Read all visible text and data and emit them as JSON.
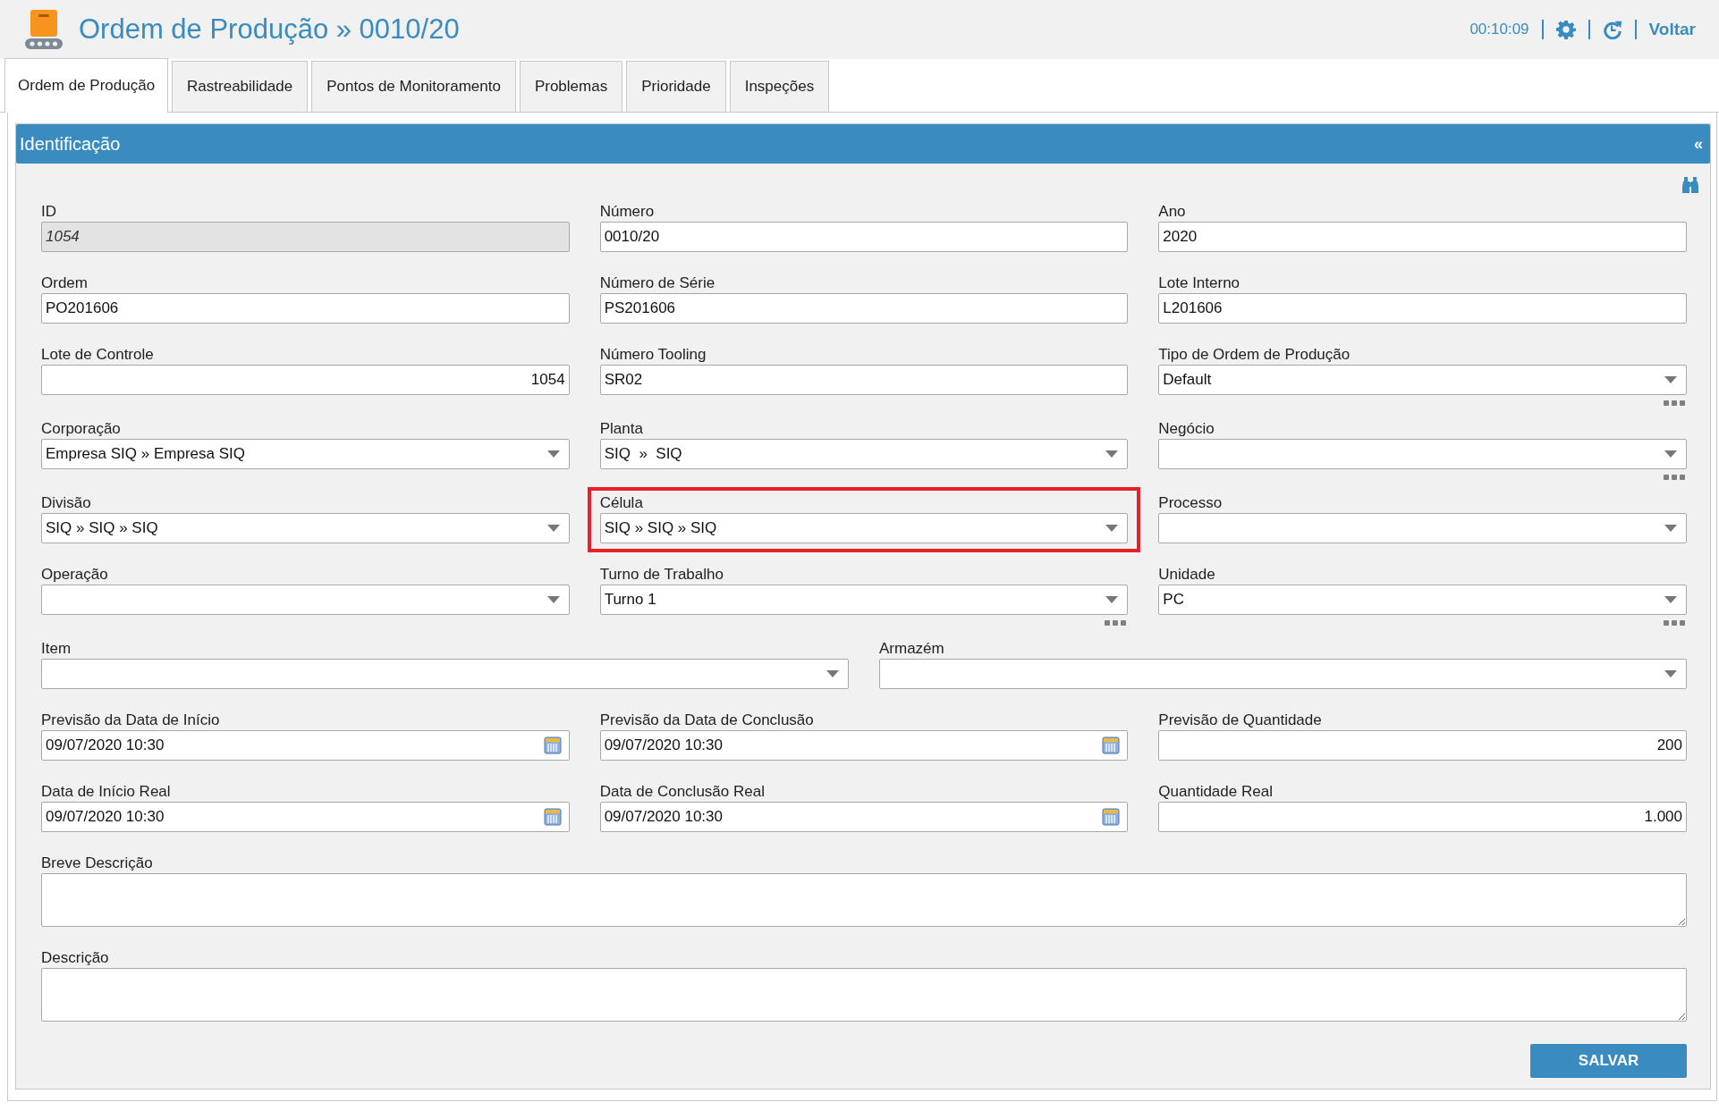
{
  "header": {
    "title": "Ordem de Produção » 0010/20",
    "timer": "00:10:09",
    "back_link": "Voltar"
  },
  "tabs": [
    {
      "label": "Ordem de Produção",
      "selected": true
    },
    {
      "label": "Rastreabilidade",
      "selected": false
    },
    {
      "label": "Pontos de Monitoramento",
      "selected": false
    },
    {
      "label": "Problemas",
      "selected": false
    },
    {
      "label": "Prioridade",
      "selected": false
    },
    {
      "label": "Inspeções",
      "selected": false
    }
  ],
  "section": {
    "title": "Identificação",
    "collapse_glyph": "«"
  },
  "rows": [
    {
      "fields": [
        {
          "label": "ID",
          "value": "1054",
          "kind": "text",
          "disabled": true,
          "highlighted": false,
          "lookup": false
        },
        {
          "label": "Número",
          "value": "0010/20",
          "kind": "text",
          "disabled": false,
          "highlighted": false,
          "lookup": false
        },
        {
          "label": "Ano",
          "value": "2020",
          "kind": "text",
          "disabled": false,
          "highlighted": false,
          "lookup": false
        }
      ]
    },
    {
      "fields": [
        {
          "label": "Ordem",
          "value": "PO201606",
          "kind": "text",
          "disabled": false,
          "highlighted": false,
          "lookup": false
        },
        {
          "label": "Número de Série",
          "value": "PS201606",
          "kind": "text",
          "disabled": false,
          "highlighted": false,
          "lookup": false
        },
        {
          "label": "Lote Interno",
          "value": "L201606",
          "kind": "text",
          "disabled": false,
          "highlighted": false,
          "lookup": false
        }
      ]
    },
    {
      "fields": [
        {
          "label": "Lote de Controle",
          "value": "1054",
          "kind": "number",
          "disabled": false,
          "highlighted": false,
          "lookup": false
        },
        {
          "label": "Número Tooling",
          "value": "SR02",
          "kind": "text",
          "disabled": false,
          "highlighted": false,
          "lookup": false
        },
        {
          "label": "Tipo de Ordem de Produção",
          "value": "Default",
          "kind": "select",
          "disabled": false,
          "highlighted": false,
          "lookup": true
        }
      ]
    },
    {
      "fields": [
        {
          "label": "Corporação",
          "value": "Empresa SIQ » Empresa SIQ",
          "kind": "select",
          "disabled": false,
          "highlighted": false,
          "lookup": false
        },
        {
          "label": "Planta",
          "value": "SIQ  »  SIQ",
          "kind": "select",
          "disabled": false,
          "highlighted": false,
          "lookup": false
        },
        {
          "label": "Negócio",
          "kind": "select",
          "disabled": false,
          "highlighted": false,
          "lookup": true
        }
      ]
    },
    {
      "fields": [
        {
          "label": "Divisão",
          "value": "SIQ » SIQ » SIQ",
          "kind": "select",
          "disabled": false,
          "highlighted": false,
          "lookup": false
        },
        {
          "label": "Célula",
          "value": "SIQ » SIQ » SIQ",
          "kind": "select",
          "disabled": false,
          "highlighted": true,
          "lookup": false
        },
        {
          "label": "Processo",
          "kind": "select",
          "disabled": false,
          "highlighted": false,
          "lookup": false
        }
      ]
    },
    {
      "fields": [
        {
          "label": "Operação",
          "kind": "select",
          "disabled": false,
          "highlighted": false,
          "lookup": false
        },
        {
          "label": "Turno de Trabalho",
          "value": "Turno 1",
          "kind": "select",
          "disabled": false,
          "highlighted": false,
          "lookup": true
        },
        {
          "label": "Unidade",
          "value": "PC",
          "kind": "select",
          "disabled": false,
          "highlighted": false,
          "lookup": true
        }
      ]
    },
    {
      "fields": [
        {
          "label": "Item",
          "kind": "select",
          "disabled": false,
          "highlighted": false,
          "lookup": false
        },
        {
          "label": "Armazém",
          "kind": "select",
          "disabled": false,
          "highlighted": false,
          "lookup": false
        }
      ]
    },
    {
      "fields": [
        {
          "label": "Previsão da Data de Início",
          "value": "09/07/2020 10:30",
          "kind": "date",
          "disabled": false,
          "highlighted": false,
          "lookup": false
        },
        {
          "label": "Previsão da Data de Conclusão",
          "value": "09/07/2020 10:30",
          "kind": "date",
          "disabled": false,
          "highlighted": false,
          "lookup": false
        },
        {
          "label": "Previsão de Quantidade",
          "value": "200",
          "kind": "number",
          "disabled": false,
          "highlighted": false,
          "lookup": false
        }
      ]
    },
    {
      "fields": [
        {
          "label": "Data de Início Real",
          "value": "09/07/2020 10:30",
          "kind": "date",
          "disabled": false,
          "highlighted": false,
          "lookup": false
        },
        {
          "label": "Data de Conclusão Real",
          "value": "09/07/2020 10:30",
          "kind": "date",
          "disabled": false,
          "highlighted": false,
          "lookup": false
        },
        {
          "label": "Quantidade Real",
          "value": "1.000",
          "kind": "number",
          "disabled": false,
          "highlighted": false,
          "lookup": false
        }
      ]
    },
    {
      "fields": [
        {
          "label": "Breve Descrição",
          "kind": "textarea",
          "disabled": false,
          "highlighted": false,
          "lookup": false
        }
      ]
    },
    {
      "fields": [
        {
          "label": "Descrição",
          "kind": "textarea",
          "disabled": false,
          "highlighted": false,
          "lookup": false
        }
      ]
    }
  ],
  "save_button": "SALVAR"
}
